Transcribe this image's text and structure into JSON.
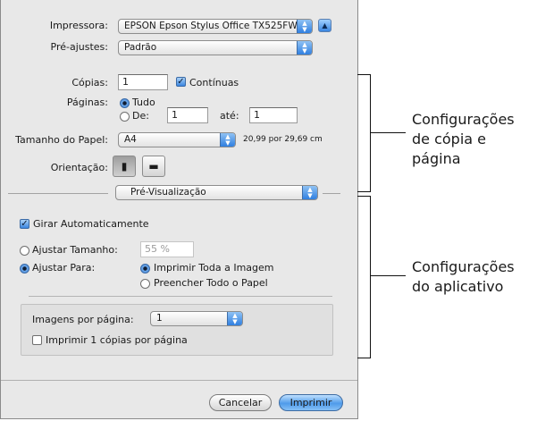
{
  "printer": {
    "label": "Impressora:",
    "value": "EPSON Epson Stylus Office TX525FW"
  },
  "presets": {
    "label": "Pré-ajustes:",
    "value": "Padrão"
  },
  "copies": {
    "label": "Cópias:",
    "value": "1",
    "collated_label": "Contínuas",
    "collated_checked": true
  },
  "pages": {
    "label": "Páginas:",
    "all_label": "Tudo",
    "from_label": "De:",
    "from_value": "1",
    "to_label": "até:",
    "to_value": "1"
  },
  "paper_size": {
    "label": "Tamanho do Papel:",
    "value": "A4",
    "dimensions": "20,99 por 29,69 cm"
  },
  "orientation": {
    "label": "Orientação:"
  },
  "section_popup": {
    "value": "Pré-Visualização"
  },
  "auto_rotate": {
    "label": "Girar Automaticamente",
    "checked": true
  },
  "scale": {
    "label": "Ajustar Tamanho:",
    "value": "55 %"
  },
  "scale_to_fit": {
    "label": "Ajustar Para:",
    "option1": "Imprimir Toda a Imagem",
    "option2": "Preencher Todo o Papel"
  },
  "images_per_page": {
    "label": "Imagens por página:",
    "value": "1"
  },
  "copies_per_page": {
    "label": "Imprimir 1 cópias por página"
  },
  "buttons": {
    "cancel": "Cancelar",
    "print": "Imprimir"
  },
  "callouts": {
    "top": [
      "Configurações",
      "de cópia e",
      "página"
    ],
    "bottom": [
      "Configurações",
      "do aplicativo"
    ]
  }
}
